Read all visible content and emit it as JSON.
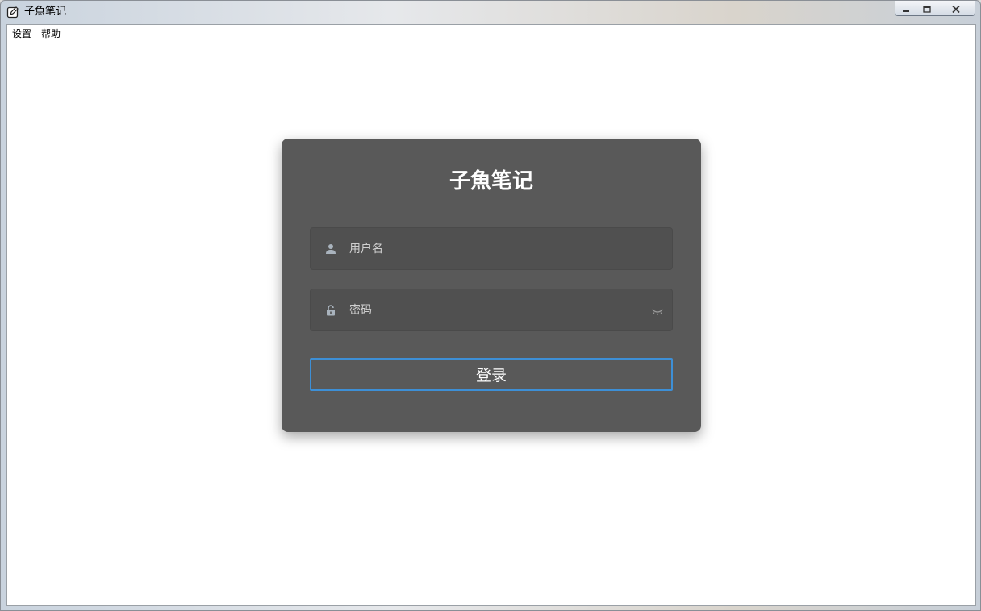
{
  "window": {
    "title": "子魚笔记",
    "icon": "note-edit-icon",
    "controls": [
      "minimize-icon",
      "maximize-icon",
      "close-icon"
    ]
  },
  "menubar": {
    "items": [
      {
        "label": "设置"
      },
      {
        "label": "帮助"
      }
    ]
  },
  "login": {
    "title": "子魚笔记",
    "username": {
      "placeholder": "用户名",
      "value": "",
      "icon": "user-icon"
    },
    "password": {
      "placeholder": "密码",
      "value": "",
      "icon": "lock-icon",
      "toggle_icon": "eye-closed-icon"
    },
    "submit_label": "登录"
  },
  "colors": {
    "card_background": "#595959",
    "field_background": "#505050",
    "button_border": "#3d8fd6",
    "text": "#ffffff"
  }
}
